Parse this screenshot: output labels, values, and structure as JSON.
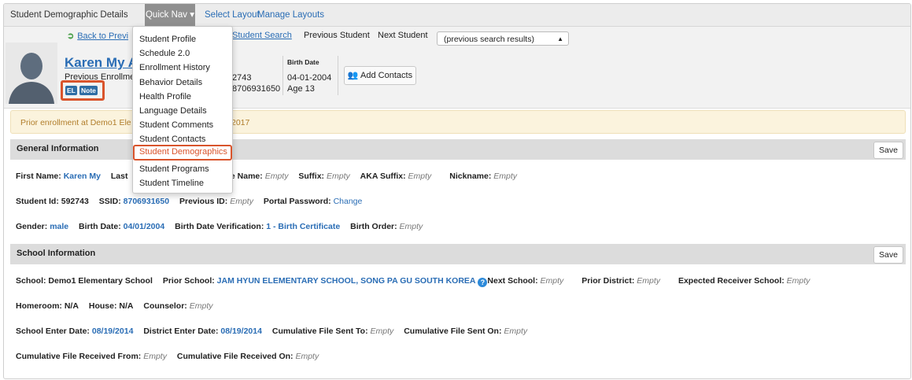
{
  "nav": {
    "title": "Student Demographic Details",
    "quick_nav": "Quick Nav ▾",
    "select_layout": "Select Layout",
    "manage_layouts": "Manage Layouts"
  },
  "header": {
    "back_link": "Back to Previous Student Search",
    "back_visible": "Back to Previ",
    "search_visible": "Student Search",
    "previous_student": "Previous Student",
    "next_student": "Next Student",
    "select_value": "(previous search results)",
    "student_name": "Karen My A",
    "previous_enrollment": "Previous Enrollme",
    "badge_el": "EL",
    "badge_note": "Note",
    "id_line1": "2743",
    "id_line2": "8706931650",
    "birth_date_header": "Birth Date",
    "birth_date": "04-01-2004",
    "age": "Age 13",
    "add_contacts": "Add Contacts"
  },
  "alert": {
    "left": "Prior enrollment at Demo1 Ele",
    "right": "2017"
  },
  "quick_nav_menu": [
    "Student Profile",
    "Schedule 2.0",
    "Enrollment History",
    "Behavior Details",
    "Health Profile",
    "Language Details",
    "Student Comments",
    "Student Contacts",
    "Student Demographics",
    "Student Programs",
    "Student Timeline"
  ],
  "sections": {
    "general": {
      "title": "General Information",
      "save": "Save"
    },
    "school": {
      "title": "School Information",
      "save": "Save"
    }
  },
  "fields": {
    "first_name_label": "First Name:",
    "first_name": "Karen My",
    "last_label": "Last",
    "middle_label": "le Name:",
    "middle": "Empty",
    "suffix_label": "Suffix:",
    "suffix": "Empty",
    "aka_label": "AKA Suffix:",
    "aka": "Empty",
    "nickname_label": "Nickname:",
    "nickname": "Empty",
    "student_id_label": "Student Id:",
    "student_id": "592743",
    "ssid_label": "SSID:",
    "ssid": "8706931650",
    "prev_id_label": "Previous ID:",
    "prev_id": "Empty",
    "portal_label": "Portal Password:",
    "portal": "Change",
    "gender_label": "Gender:",
    "gender": "male",
    "bd_label": "Birth Date:",
    "bd": "04/01/2004",
    "bdv_label": "Birth Date Verification:",
    "bdv": "1 - Birth Certificate",
    "order_label": "Birth Order:",
    "order": "Empty",
    "school_label": "School:",
    "school": "Demo1 Elementary School",
    "prior_school_label": "Prior School:",
    "prior_school": "JAM HYUN ELEMENTARY SCHOOL, SONG PA GU SOUTH KOREA",
    "help": "?",
    "next_school_label": "Next School:",
    "next_school": "Empty",
    "prior_district_label": "Prior District:",
    "prior_district": "Empty",
    "expected_label": "Expected Receiver School:",
    "expected": "Empty",
    "homeroom_label": "Homeroom:",
    "homeroom": "N/A",
    "house_label": "House:",
    "house": "N/A",
    "counselor_label": "Counselor:",
    "counselor": "Empty",
    "enter_label": "School Enter Date:",
    "enter": "08/19/2014",
    "district_label": "District Enter Date:",
    "district": "08/19/2014",
    "sent_to_label": "Cumulative File Sent To:",
    "sent_to": "Empty",
    "sent_on_label": "Cumulative File Sent On:",
    "sent_on": "Empty",
    "recv_from_label": "Cumulative File Received From:",
    "recv_from": "Empty",
    "recv_on_label": "Cumulative File Received On:",
    "recv_on": "Empty"
  },
  "colors": {
    "link": "#2a6db5",
    "highlight": "#d9542c",
    "alert_bg": "#fbf3dd"
  }
}
